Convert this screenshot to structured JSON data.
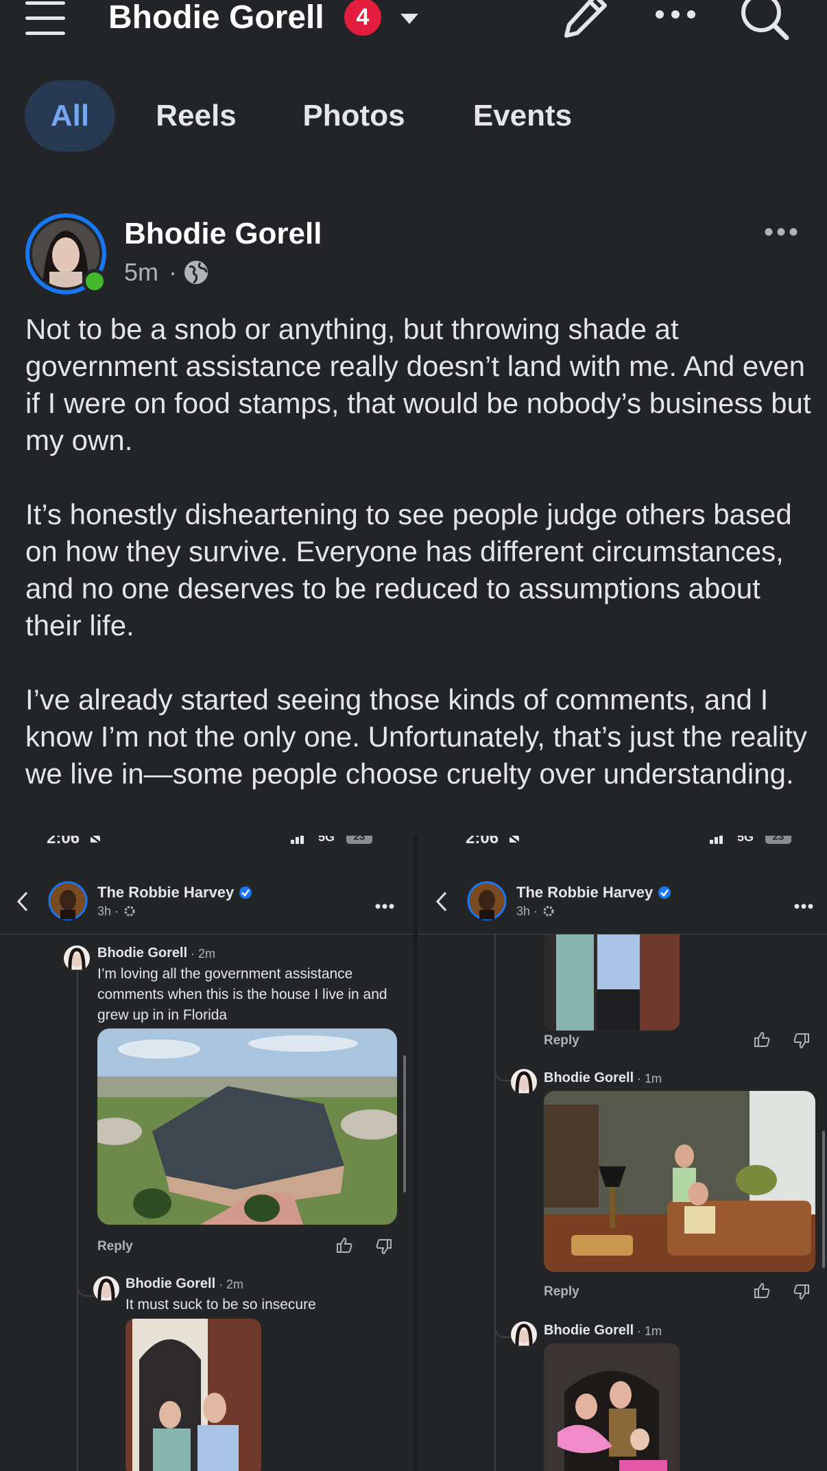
{
  "header": {
    "title": "Bhodie Gorell",
    "notification_count": "4"
  },
  "tabs": [
    {
      "label": "All",
      "active": true
    },
    {
      "label": "Reels"
    },
    {
      "label": "Photos"
    },
    {
      "label": "Events"
    }
  ],
  "post": {
    "author": "Bhodie Gorell",
    "time": "5m",
    "text": "Not to be a snob or anything, but throwing shade at government assistance really doesn’t land with me. And even if I were on food stamps, that would be nobody’s business but my own.\n\nIt’s honestly disheartening to see people judge others based on how they survive. Everyone has different circumstances, and no one deserves to be reduced to assumptions about their life.\n\nI’ve already started seeing those kinds of comments, and I know I’m not the only one. Unfortunately, that’s just the reality we live in—some people choose cruelty over understanding."
  },
  "screenshots": [
    {
      "status_time": "2:06",
      "status_net": "5G",
      "status_battery": "23",
      "page_name": "The Robbie Harvey",
      "page_meta": "3h ·",
      "comments": [
        {
          "name": "Bhodie Gorell",
          "time": "· 2m",
          "text": "I’m loving all the government assistance comments when this is the house I live in and grew up in in Florida",
          "reply": "Reply"
        },
        {
          "name": "Bhodie Gorell",
          "time": "· 2m",
          "text": "It must suck to be so insecure"
        }
      ]
    },
    {
      "status_time": "2:06",
      "status_net": "5G",
      "status_battery": "23",
      "page_name": "The Robbie Harvey",
      "page_meta": "3h ·",
      "comments": [
        {
          "reply": "Reply"
        },
        {
          "name": "Bhodie Gorell",
          "time": "· 1m",
          "reply": "Reply"
        },
        {
          "name": "Bhodie Gorell",
          "time": "· 1m"
        }
      ]
    }
  ],
  "colors": {
    "background": "#232428",
    "accent": "#75a7f0",
    "badge": "#e41e3f",
    "online": "#42b72a",
    "verified": "#1877f2"
  }
}
